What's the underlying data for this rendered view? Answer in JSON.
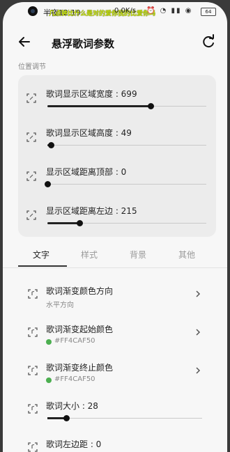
{
  "status_bar": {
    "time": "半夜12:19",
    "network_speed": "0.0K/s",
    "lyric_banner": "几点钟比什么是对的爱你我的比爱你吗",
    "battery": "64"
  },
  "app_bar": {
    "title": "悬浮歌词参数"
  },
  "position_section": {
    "label": "位置调节",
    "sliders": [
      {
        "label": "歌词显示区域宽度 : 699",
        "value": 0.65
      },
      {
        "label": "歌词显示区域高度 : 49",
        "value": 0.02
      },
      {
        "label": "显示区域距离顶部 : 0",
        "value": 0.0
      },
      {
        "label": "显示区域距离左边 : 215",
        "value": 0.2
      }
    ]
  },
  "tabs": [
    {
      "label": "文字",
      "active": true
    },
    {
      "label": "样式",
      "active": false
    },
    {
      "label": "背景",
      "active": false
    },
    {
      "label": "其他",
      "active": false
    }
  ],
  "text_settings": {
    "gradient_direction": {
      "label": "歌词渐变颜色方向",
      "value": "水平方向"
    },
    "gradient_start": {
      "label": "歌词渐变起始颜色",
      "value": "#FF4CAF50",
      "color": "#4CAF50"
    },
    "gradient_end": {
      "label": "歌词渐变终止颜色",
      "value": "#FF4CAF50",
      "color": "#4CAF50"
    },
    "font_size": {
      "label": "歌词大小 : 28",
      "value": 0.12
    },
    "left_margin": {
      "label": "歌词左边距 : 0"
    }
  },
  "colors": {
    "accent_dark": "#222222",
    "banner": "#c8e600"
  }
}
